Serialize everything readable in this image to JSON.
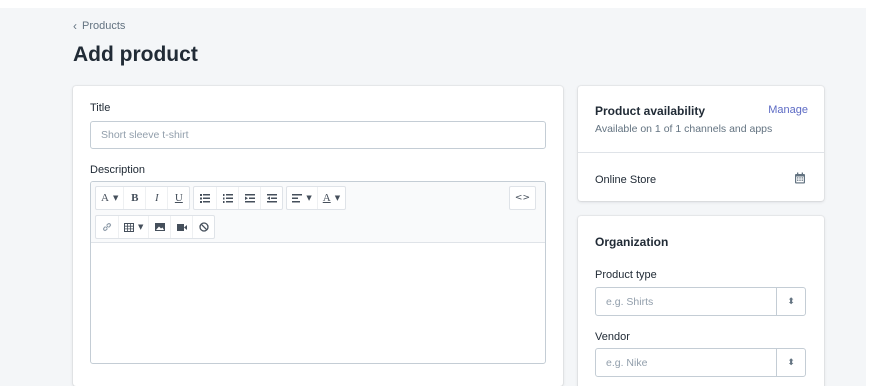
{
  "header": {
    "breadcrumb": "Products",
    "title": "Add product"
  },
  "main": {
    "title_label": "Title",
    "title_placeholder": "Short sleeve t-shirt",
    "description_label": "Description",
    "toolbar": {
      "font": "A",
      "bold": "B",
      "italic": "I",
      "underline": "U",
      "text_color": "A",
      "code": "<>",
      "icons": [
        "font-icon",
        "bold-icon",
        "italic-icon",
        "underline-icon",
        "bulleted-list-icon",
        "numbered-list-icon",
        "outdent-icon",
        "indent-icon",
        "align-left-icon",
        "text-color-icon",
        "code-icon",
        "link-icon",
        "table-icon",
        "image-icon",
        "video-icon",
        "clear-format-icon"
      ]
    }
  },
  "availability": {
    "title": "Product availability",
    "manage": "Manage",
    "subtitle": "Available on 1 of 1 channels and apps",
    "channel": "Online Store"
  },
  "organization": {
    "title": "Organization",
    "product_type_label": "Product type",
    "product_type_placeholder": "e.g. Shirts",
    "vendor_label": "Vendor",
    "vendor_placeholder": "e.g. Nike"
  },
  "colors": {
    "accent": "#5c6ac4",
    "page_bg": "#f4f6f8",
    "border": "#c4cdd5"
  }
}
